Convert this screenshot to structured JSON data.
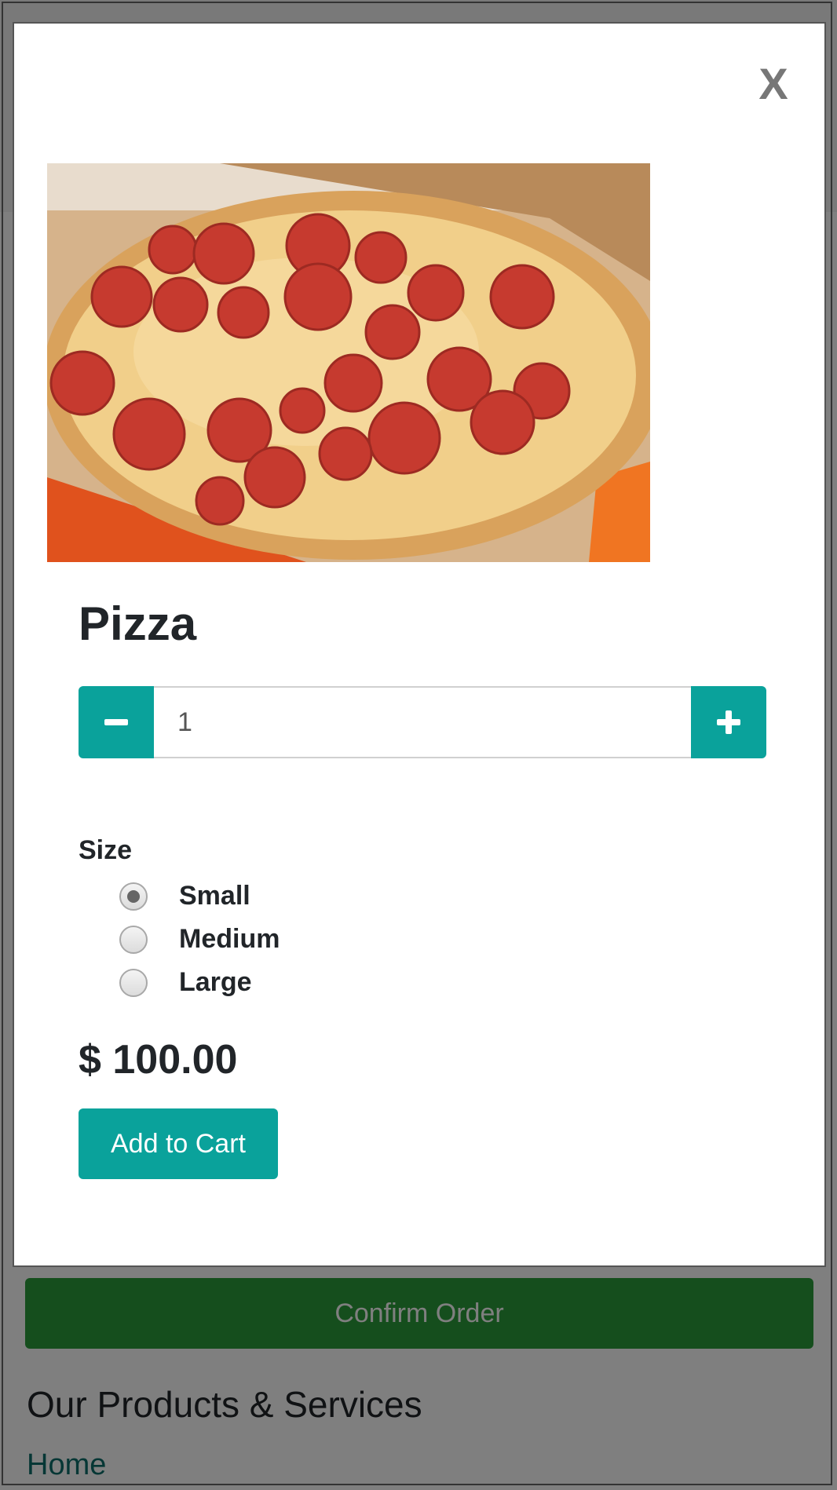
{
  "modal": {
    "close_label": "X",
    "product": {
      "image_alt": "pepperoni-pizza-photo",
      "name": "Pizza",
      "quantity": "1",
      "size_label": "Size",
      "sizes": [
        {
          "label": "Small",
          "selected": true
        },
        {
          "label": "Medium",
          "selected": false
        },
        {
          "label": "Large",
          "selected": false
        }
      ],
      "price": "$ 100.00",
      "add_to_cart_label": "Add to Cart"
    },
    "icons": {
      "decrement": "minus-icon",
      "increment": "plus-icon"
    }
  },
  "page": {
    "confirm_label": "Confirm Order",
    "section_title": "Our Products & Services",
    "nav_link": "Home"
  },
  "colors": {
    "accent": "#0aa29b",
    "confirm": "#2a9d3a",
    "link": "#0d6e6a",
    "text": "#212529"
  }
}
